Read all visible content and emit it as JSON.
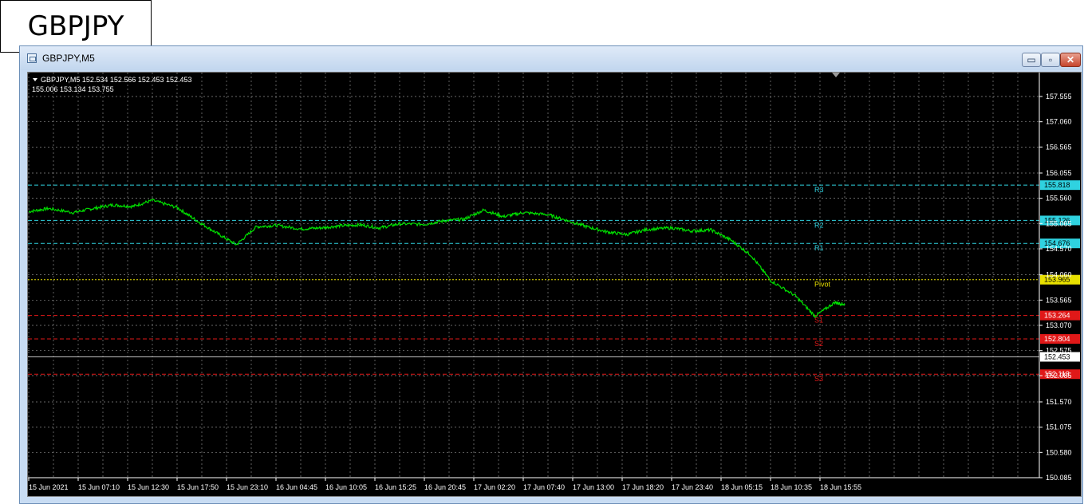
{
  "caption": "GBPJPY",
  "window": {
    "title": "GBPJPY,M5",
    "controls": {
      "minimize": "▭",
      "maximize": "▫",
      "close": "✕"
    }
  },
  "colors": {
    "background": "#000000",
    "grid": "#8a8a8a",
    "price_line": "#00e000",
    "resistance": "#2fd2e0",
    "pivot": "#e8e000",
    "support": "#e01818",
    "axis_text": "#ffffff",
    "current_price_label": "#ffffff"
  },
  "chart_data": {
    "type": "line",
    "symbol_info": {
      "line1": "GBPJPY,M5  152.534 152.566 152.453 152.453",
      "line2": "155.006 153.134 153.755"
    },
    "grid": true,
    "ylim": [
      150.085,
      157.555
    ],
    "y_ticks": [
      "157.555",
      "157.060",
      "156.565",
      "156.055",
      "155.560",
      "155.065",
      "154.570",
      "154.060",
      "153.565",
      "153.070",
      "152.575",
      "152.085",
      "151.570",
      "151.075",
      "150.580",
      "150.085"
    ],
    "x_ticks": [
      "15 Jun 2021",
      "15 Jun 07:10",
      "15 Jun 12:30",
      "15 Jun 17:50",
      "15 Jun 23:10",
      "16 Jun 04:45",
      "16 Jun 10:05",
      "16 Jun 15:25",
      "16 Jun 20:45",
      "17 Jun 02:20",
      "17 Jun 07:40",
      "17 Jun 13:00",
      "17 Jun 18:20",
      "17 Jun 23:40",
      "18 Jun 05:15",
      "18 Jun 10:35",
      "18 Jun 15:55"
    ],
    "levels": [
      {
        "name": "R3",
        "value": 155.818,
        "label": "155.818",
        "kind": "resistance"
      },
      {
        "name": "R2",
        "value": 155.126,
        "label": "155.126",
        "kind": "resistance"
      },
      {
        "name": "R1",
        "value": 154.676,
        "label": "154.676",
        "kind": "resistance"
      },
      {
        "name": "Pivot",
        "value": 153.965,
        "label": "153.965",
        "kind": "pivot"
      },
      {
        "name": "S1",
        "value": 153.264,
        "label": "153.264",
        "kind": "support"
      },
      {
        "name": "S2",
        "value": 152.804,
        "label": "152.804",
        "kind": "support"
      },
      {
        "name": "S3",
        "value": 152.113,
        "label": "152.113",
        "kind": "support"
      }
    ],
    "current_price": {
      "value": 152.453,
      "label": "152.453"
    },
    "series": [
      {
        "x_index": [
          0.0,
          0.4,
          0.9,
          1.3,
          1.7,
          2.1,
          2.5,
          3.0,
          3.4,
          3.8,
          4.2,
          4.6,
          5.0,
          5.5,
          5.9,
          6.3,
          6.7,
          7.1,
          7.5,
          8.0,
          8.4,
          8.8,
          9.2,
          9.6,
          10.0,
          10.5,
          10.9,
          11.3,
          11.7,
          12.1,
          12.5,
          13.0,
          13.4,
          13.8,
          14.2,
          14.6,
          15.0,
          15.5,
          15.9,
          16.3,
          16.5
        ],
        "values": [
          155.3,
          155.36,
          155.28,
          155.36,
          155.43,
          155.4,
          155.52,
          155.38,
          155.12,
          154.88,
          154.65,
          155.0,
          155.03,
          154.96,
          154.98,
          155.02,
          155.04,
          154.98,
          155.06,
          155.05,
          155.12,
          155.15,
          155.33,
          155.2,
          155.28,
          155.24,
          155.12,
          155.0,
          154.9,
          154.85,
          154.95,
          154.98,
          154.92,
          154.94,
          154.74,
          154.45,
          153.95,
          153.65,
          153.25,
          153.52,
          153.48
        ]
      }
    ]
  }
}
